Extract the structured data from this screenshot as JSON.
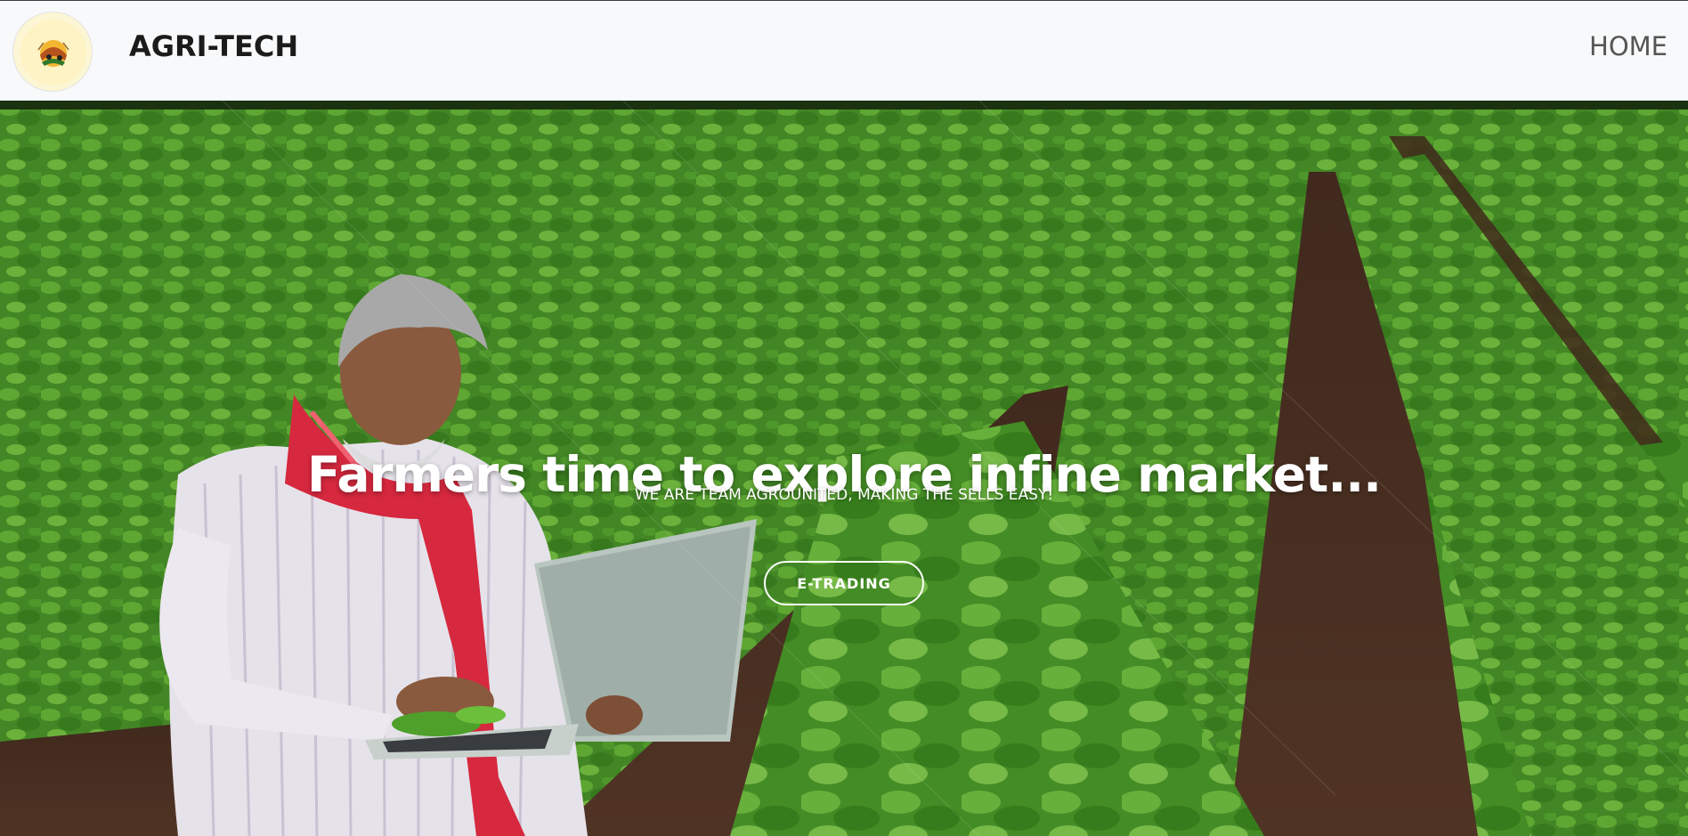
{
  "navbar": {
    "brand": "AGRI-TECH",
    "logo_icon": "agri-logo-icon",
    "links": [
      {
        "label": "HOME"
      }
    ]
  },
  "hero": {
    "title": "Farmers time to explore infine market...",
    "subtitle": "WE ARE TEAM AGROUNITED, MAKING THE SELLS EASY!",
    "cta_label": "E-TRADING",
    "background": "farmer-with-laptop-in-cotton-field-photo"
  },
  "colors": {
    "navbar_bg": "#f8f9fa",
    "brand_text": "#1b1b1b",
    "nav_link": "#555555",
    "field_green": "#4c9a2a",
    "soil_brown": "#5a3a28",
    "scarf_red": "#d6283e"
  }
}
